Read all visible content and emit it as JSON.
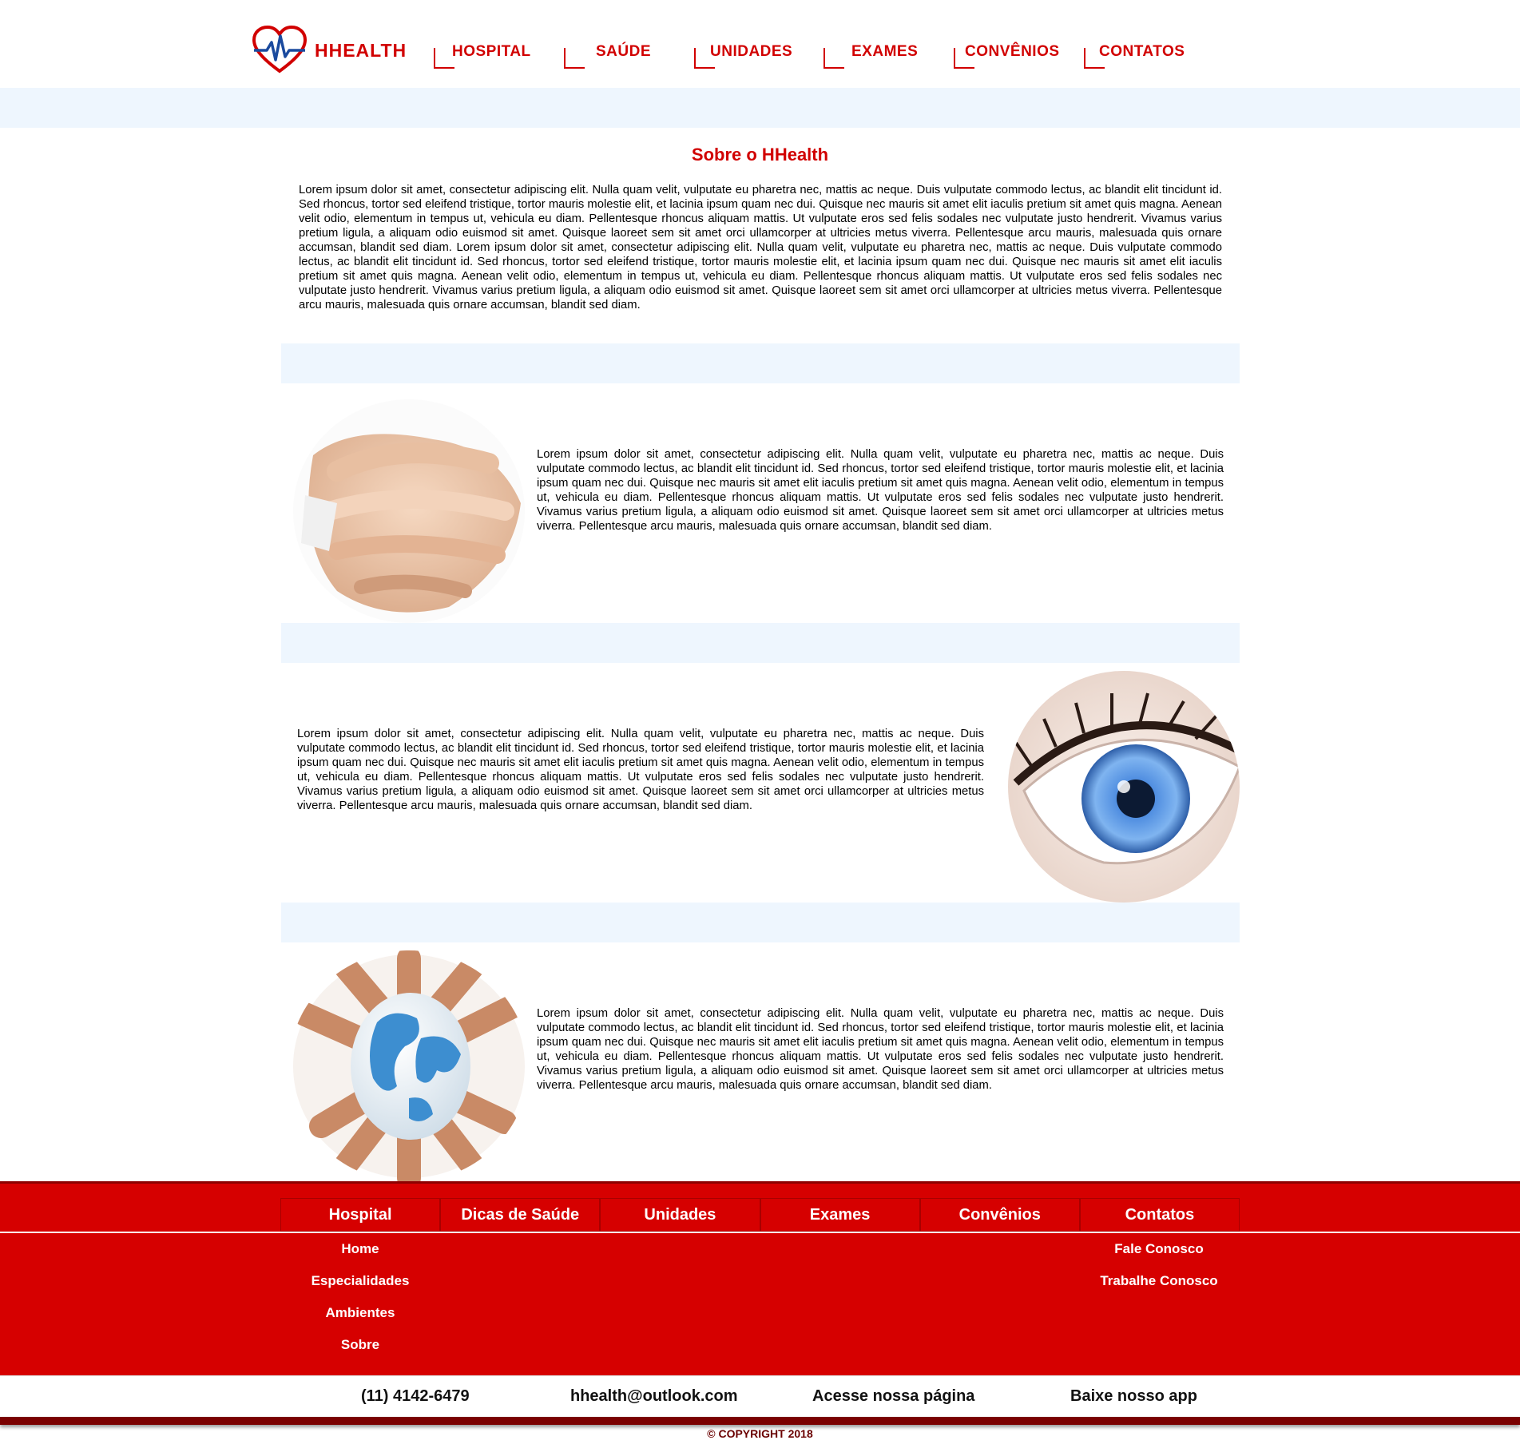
{
  "brand": {
    "name": "HHEALTH",
    "accent_color": "#d10000",
    "logo_icon": "heart-pulse-icon"
  },
  "nav": [
    {
      "label": "HOSPITAL"
    },
    {
      "label": "SAÚDE"
    },
    {
      "label": "UNIDADES"
    },
    {
      "label": "EXAMES"
    },
    {
      "label": "CONVÊNIOS"
    },
    {
      "label": "CONTATOS"
    }
  ],
  "about": {
    "title": "Sobre o HHealth",
    "text": "Lorem ipsum dolor sit amet, consectetur adipiscing elit. Nulla quam velit, vulputate eu pharetra nec, mattis ac neque. Duis vulputate commodo lectus, ac blandit elit tincidunt id. Sed rhoncus, tortor sed eleifend tristique, tortor mauris molestie elit, et lacinia ipsum quam nec dui. Quisque nec mauris sit amet elit iaculis pretium sit amet quis magna. Aenean velit odio, elementum in tempus ut, vehicula eu diam. Pellentesque rhoncus aliquam mattis. Ut vulputate eros sed felis sodales nec vulputate justo hendrerit. Vivamus varius pretium ligula, a aliquam odio euismod sit amet. Quisque laoreet sem sit amet orci ullamcorper at ultricies metus viverra. Pellentesque arcu mauris, malesuada quis ornare accumsan, blandit sed diam. Lorem ipsum dolor sit amet, consectetur adipiscing elit. Nulla quam velit, vulputate eu pharetra nec, mattis ac neque. Duis vulputate commodo lectus, ac blandit elit tincidunt id. Sed rhoncus, tortor sed eleifend tristique, tortor mauris molestie elit, et lacinia ipsum quam nec dui. Quisque nec mauris sit amet elit iaculis pretium sit amet quis magna. Aenean velit odio, elementum in tempus ut, vehicula eu diam. Pellentesque rhoncus aliquam mattis. Ut vulputate eros sed felis sodales nec vulputate justo hendrerit. Vivamus varius pretium ligula, a aliquam odio euismod sit amet. Quisque laoreet sem sit amet orci ullamcorper at ultricies metus viverra. Pellentesque arcu mauris, malesuada quis ornare accumsan, blandit sed diam."
  },
  "rows": [
    {
      "image": "stacked-hands-image",
      "text": "Lorem ipsum dolor sit amet, consectetur adipiscing elit. Nulla quam velit, vulputate eu pharetra nec, mattis ac neque. Duis vulputate commodo lectus, ac blandit elit tincidunt id. Sed rhoncus, tortor sed eleifend tristique, tortor mauris molestie elit, et lacinia ipsum quam nec dui. Quisque nec mauris sit amet elit iaculis pretium sit amet quis magna. Aenean velit odio, elementum in tempus ut, vehicula eu diam. Pellentesque rhoncus aliquam mattis. Ut vulputate eros sed felis sodales nec vulputate justo hendrerit. Vivamus varius pretium ligula, a aliquam odio euismod sit amet. Quisque laoreet sem sit amet orci ullamcorper at ultricies metus viverra. Pellentesque arcu mauris, malesuada quis ornare accumsan, blandit sed diam."
    },
    {
      "image": "blue-eye-image",
      "text": "Lorem ipsum dolor sit amet, consectetur adipiscing elit. Nulla quam velit, vulputate eu pharetra nec, mattis ac neque. Duis vulputate commodo lectus, ac blandit elit tincidunt id. Sed rhoncus, tortor sed eleifend tristique, tortor mauris molestie elit, et lacinia ipsum quam nec dui. Quisque nec mauris sit amet elit iaculis pretium sit amet quis magna. Aenean velit odio, elementum in tempus ut, vehicula eu diam. Pellentesque rhoncus aliquam mattis. Ut vulputate eros sed felis sodales nec vulputate justo hendrerit. Vivamus varius pretium ligula, a aliquam odio euismod sit amet. Quisque laoreet sem sit amet orci ullamcorper at ultricies metus viverra. Pellentesque arcu mauris, malesuada quis ornare accumsan, blandit sed diam."
    },
    {
      "image": "hands-holding-globe-image",
      "text": "Lorem ipsum dolor sit amet, consectetur adipiscing elit. Nulla quam velit, vulputate eu pharetra nec, mattis ac neque. Duis vulputate commodo lectus, ac blandit elit tincidunt id. Sed rhoncus, tortor sed eleifend tristique, tortor mauris molestie elit, et lacinia ipsum quam nec dui. Quisque nec mauris sit amet elit iaculis pretium sit amet quis magna. Aenean velit odio, elementum in tempus ut, vehicula eu diam. Pellentesque rhoncus aliquam mattis. Ut vulputate eros sed felis sodales nec vulputate justo hendrerit. Vivamus varius pretium ligula, a aliquam odio euismod sit amet. Quisque laoreet sem sit amet orci ullamcorper at ultricies metus viverra. Pellentesque arcu mauris, malesuada quis ornare accumsan, blandit sed diam."
    }
  ],
  "footer": {
    "background_color": "#d60000",
    "tabs": [
      {
        "label": "Hospital"
      },
      {
        "label": "Dicas de Saúde"
      },
      {
        "label": "Unidades"
      },
      {
        "label": "Exames"
      },
      {
        "label": "Convênios"
      },
      {
        "label": "Contatos"
      }
    ],
    "hospital_links": [
      "Home",
      "Especialidades",
      "Ambientes",
      "Sobre"
    ],
    "contatos_links": [
      "Fale Conosco",
      "Trabalhe Conosco"
    ]
  },
  "contact_bar": {
    "phone": "(11) 4142-6479",
    "email": "hhealth@outlook.com",
    "page": "Acesse nossa página",
    "app": "Baixe nosso app"
  },
  "copyright": "© COPYRIGHT 2018"
}
